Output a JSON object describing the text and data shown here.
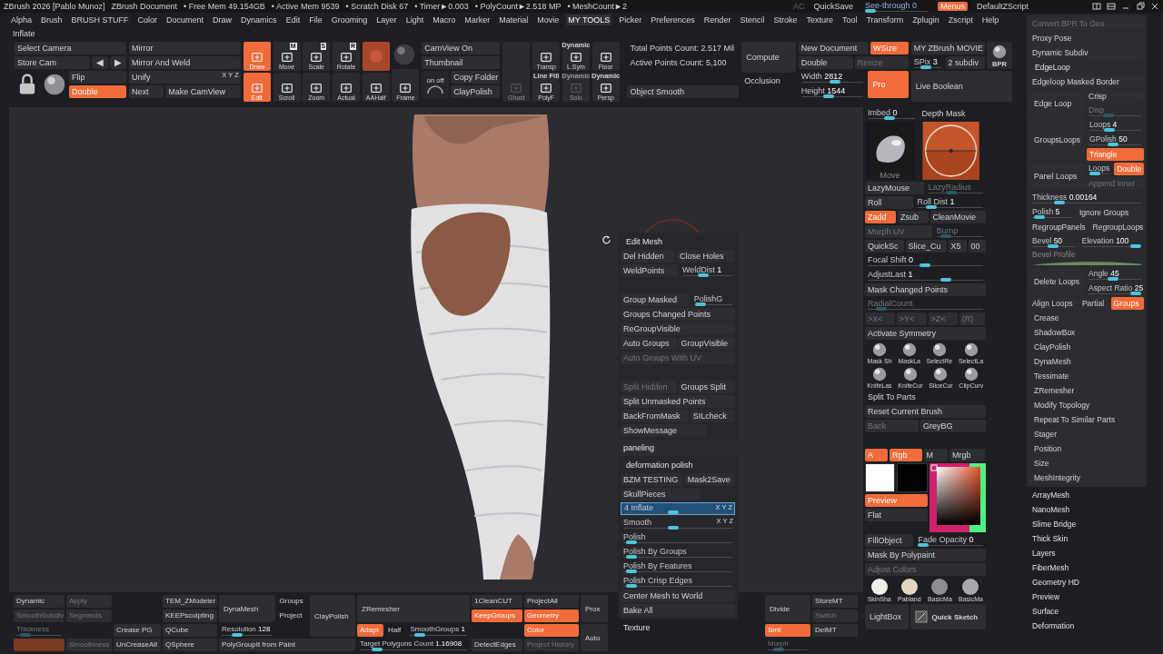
{
  "title_bar": {
    "app": "ZBrush 2026 [Pablo Munoz]",
    "document": "ZBrush Document",
    "stats": [
      "• Free Mem 49.154GB",
      "• Active Mem 9539",
      "• Scratch Disk 67",
      "• Timer►0.003",
      "• PolyCount►2.518 MP",
      "• MeshCount►2"
    ],
    "ac": "AC",
    "quicksave": "QuickSave",
    "see_through": {
      "text": "See-through",
      "value": "0",
      "level": 0
    },
    "menus": {
      "text": "Menus",
      "on": true
    },
    "script": "DefaultZScript"
  },
  "menu_bar": [
    {
      "text": "Alpha",
      "selected": false
    },
    {
      "text": "Brush",
      "selected": false
    },
    {
      "text": "BRUSH STUFF",
      "selected": false
    },
    {
      "text": "Color",
      "selected": false
    },
    {
      "text": "Document",
      "selected": false
    },
    {
      "text": "Draw",
      "selected": false
    },
    {
      "text": "Dynamics",
      "selected": false
    },
    {
      "text": "Edit",
      "selected": false
    },
    {
      "text": "File",
      "selected": false
    },
    {
      "text": "Grooming",
      "selected": false
    },
    {
      "text": "Layer",
      "selected": false
    },
    {
      "text": "Light",
      "selected": false
    },
    {
      "text": "Macro",
      "selected": false
    },
    {
      "text": "Marker",
      "selected": false
    },
    {
      "text": "Material",
      "selected": false
    },
    {
      "text": "Movie",
      "selected": false
    },
    {
      "text": "MY TOOLS",
      "selected": true
    },
    {
      "text": "Picker",
      "selected": false
    },
    {
      "text": "Preferences",
      "selected": false
    },
    {
      "text": "Render",
      "selected": false
    },
    {
      "text": "Stencil",
      "selected": false
    },
    {
      "text": "Stroke",
      "selected": false
    },
    {
      "text": "Texture",
      "selected": false
    },
    {
      "text": "Tool",
      "selected": false
    },
    {
      "text": "Transform",
      "selected": false
    },
    {
      "text": "Zplugin",
      "selected": false
    },
    {
      "text": "Zscript",
      "selected": false
    },
    {
      "text": "Help",
      "selected": false
    }
  ],
  "active_item": "Inflate",
  "toolbar": [
    {
      "kind": "stack",
      "items": [
        {
          "kind": "btn",
          "text": "Select Camera",
          "on": false
        },
        {
          "kind": "row",
          "items": [
            {
              "kind": "btn",
              "text": "Store Cam",
              "on": false
            },
            {
              "kind": "glyph",
              "text": "◀"
            },
            {
              "kind": "glyph",
              "text": "▶"
            }
          ]
        },
        {
          "kind": "row",
          "items": [
            {
              "kind": "lock"
            },
            {
              "kind": "sphere"
            },
            {
              "kind": "stack",
              "items": [
                {
                  "kind": "btn",
                  "text": "Flip",
                  "on": false
                },
                {
                  "kind": "btn",
                  "text": "Double",
                  "on": true
                }
              ]
            }
          ]
        }
      ]
    },
    {
      "kind": "stack",
      "items": [
        {
          "kind": "btn",
          "text": "Mirror",
          "on": false
        },
        {
          "kind": "btn",
          "text": "Mirror And Weld",
          "on": false
        },
        {
          "kind": "btn",
          "text": "Unify",
          "on": false,
          "tag": "X Y Z"
        },
        {
          "kind": "row",
          "items": [
            {
              "kind": "btn",
              "text": "Next",
              "on": false
            },
            {
              "kind": "btn",
              "text": "Make CamView",
              "on": false
            }
          ]
        }
      ]
    },
    {
      "kind": "stack",
      "items": [
        {
          "kind": "tool",
          "text": "Draw",
          "on": true
        },
        {
          "kind": "tool",
          "text": "Edit",
          "on": true
        }
      ]
    },
    {
      "kind": "stack",
      "items": [
        {
          "kind": "tool",
          "text": "Move",
          "key": "M",
          "on": false
        },
        {
          "kind": "tool",
          "text": "Scroll",
          "on": false
        }
      ]
    },
    {
      "kind": "stack",
      "items": [
        {
          "kind": "tool",
          "text": "Scale",
          "key": "S",
          "on": false
        },
        {
          "kind": "tool",
          "text": "Zoom",
          "on": false
        }
      ]
    },
    {
      "kind": "stack",
      "items": [
        {
          "kind": "tool",
          "text": "Rotate",
          "key": "R",
          "on": false
        },
        {
          "kind": "tool",
          "text": "Actual",
          "on": false
        }
      ]
    },
    {
      "kind": "stack",
      "items": [
        {
          "kind": "material-swatch"
        },
        {
          "kind": "tool",
          "text": "AAHalf",
          "on": false
        }
      ]
    },
    {
      "kind": "stack",
      "items": [
        {
          "kind": "dark-sphere"
        },
        {
          "kind": "tool",
          "text": "Frame",
          "on": false
        }
      ]
    },
    {
      "kind": "stack",
      "items": [
        {
          "kind": "btn",
          "text": "CamView On",
          "on": false
        },
        {
          "kind": "btn",
          "text": "Thumbnail",
          "on": false
        },
        {
          "kind": "row",
          "items": [
            {
              "kind": "dial",
              "text": "on off"
            },
            {
              "kind": "stack",
              "items": [
                {
                  "kind": "btn",
                  "text": "Copy Folder",
                  "on": false
                },
                {
                  "kind": "btn",
                  "text": "ClayPolish",
                  "on": false
                }
              ]
            }
          ]
        }
      ]
    },
    {
      "kind": "stack",
      "items": [
        {
          "kind": "dim-tool",
          "text": "Ghost"
        }
      ]
    },
    {
      "kind": "stack",
      "items": [
        {
          "kind": "tool",
          "text": "Transp",
          "on": false
        },
        {
          "kind": "tool",
          "text": "PolyF",
          "caption": "Line Fill",
          "on": false
        }
      ]
    },
    {
      "kind": "stack",
      "items": [
        {
          "kind": "tool",
          "text": "L.Sym",
          "caption": "Dynamic",
          "on": false
        },
        {
          "kind": "dim-tool",
          "text": "Solo",
          "caption": "Dynamic"
        }
      ]
    },
    {
      "kind": "stack",
      "items": [
        {
          "kind": "tool",
          "text": "Floor",
          "on": false
        },
        {
          "kind": "tool",
          "text": "Persp",
          "caption": "Dynamic",
          "on": false
        }
      ]
    },
    {
      "kind": "stack",
      "items": [
        {
          "kind": "text",
          "text": "Total Points Count: 2.517 Mil"
        },
        {
          "kind": "text",
          "text": "Active Points Count: 5,100"
        },
        {
          "kind": "gap"
        },
        {
          "kind": "btn",
          "text": "Object Smooth",
          "on": false
        }
      ]
    },
    {
      "kind": "stack",
      "items": [
        {
          "kind": "big-btn",
          "text": "Compute",
          "on": false
        },
        {
          "kind": "text",
          "text": "Occlusion"
        },
        {
          "kind": "gap"
        }
      ]
    },
    {
      "kind": "stack",
      "items": [
        {
          "kind": "row",
          "items": [
            {
              "kind": "btn",
              "text": "New Document",
              "on": false
            },
            {
              "kind": "btn",
              "text": "WSize",
              "on": true
            }
          ]
        },
        {
          "kind": "row",
          "items": [
            {
              "kind": "btn",
              "text": "Double",
              "on": false
            },
            {
              "kind": "dim",
              "text": "Resize"
            }
          ]
        },
        {
          "kind": "row",
          "items": [
            {
              "kind": "stack",
              "items": [
                {
                  "kind": "slider",
                  "text": "Width",
                  "value": "2812",
                  "level": 0.55
                },
                {
                  "kind": "slider",
                  "text": "Height",
                  "value": "1544",
                  "level": 0.42
                }
              ]
            },
            {
              "kind": "big-btn",
              "text": "Pro",
              "on": true
            }
          ]
        }
      ]
    },
    {
      "kind": "stack",
      "items": [
        {
          "kind": "row",
          "items": [
            {
              "kind": "stack",
              "items": [
                {
                  "kind": "btn",
                  "text": "MY ZBrush MOVIE",
                  "on": false
                },
                {
                  "kind": "row",
                  "items": [
                    {
                      "kind": "slider",
                      "text": "SPix",
                      "value": "3",
                      "level": 0.4
                    },
                    {
                      "kind": "btn",
                      "text": "2 subdiv",
                      "on": false
                    }
                  ]
                }
              ]
            },
            {
              "kind": "bpr",
              "text": "BPR"
            }
          ]
        },
        {
          "kind": "big-btn",
          "text": "Live Boolean",
          "on": false
        }
      ]
    }
  ],
  "popup_menu": [
    {
      "kind": "card",
      "items": [
        {
          "kind": "heading",
          "text": "Edit Mesh"
        },
        {
          "kind": "row",
          "items": [
            {
              "kind": "btn",
              "text": "Del Hidden",
              "on": false
            },
            {
              "kind": "btn",
              "text": "Close Holes",
              "on": false
            }
          ]
        },
        {
          "kind": "row",
          "items": [
            {
              "kind": "btn",
              "text": "WeldPoints",
              "on": false
            },
            {
              "kind": "slider",
              "text": "WeldDist",
              "value": "1",
              "level": 0.4
            }
          ]
        },
        {
          "kind": "gap"
        },
        {
          "kind": "row",
          "items": [
            {
              "kind": "btn",
              "text": "Group Masked",
              "on": false
            },
            {
              "kind": "slider",
              "text": "PolishG",
              "level": 0.05
            }
          ]
        },
        {
          "kind": "btn",
          "text": "Groups Changed Points",
          "on": false
        },
        {
          "kind": "btn",
          "text": "ReGroupVisible",
          "on": false
        },
        {
          "kind": "row",
          "items": [
            {
              "kind": "btn",
              "text": "Auto Groups",
              "on": false
            },
            {
              "kind": "btn",
              "text": "GroupVisible",
              "on": false
            }
          ]
        },
        {
          "kind": "dim",
          "text": "Auto Groups With UV"
        },
        {
          "kind": "gap"
        },
        {
          "kind": "row",
          "items": [
            {
              "kind": "dim",
              "text": "Split Hidden"
            },
            {
              "kind": "btn",
              "text": "Groups Split",
              "on": false
            }
          ]
        },
        {
          "kind": "btn",
          "text": "Split Unmasked Points",
          "on": false
        },
        {
          "kind": "row",
          "items": [
            {
              "kind": "btn",
              "text": "BackFromMask",
              "on": false
            },
            {
              "kind": "btn",
              "text": "SILcheck",
              "on": false
            }
          ]
        },
        {
          "kind": "row",
          "items": [
            {
              "kind": "btn",
              "text": "ShowMessage",
              "on": false
            },
            {
              "kind": "gap"
            }
          ]
        }
      ]
    },
    {
      "kind": "heading",
      "text": "paneling"
    },
    {
      "kind": "card",
      "items": [
        {
          "kind": "heading",
          "text": "deformation polish"
        },
        {
          "kind": "row",
          "items": [
            {
              "kind": "btn",
              "text": "BZM TESTING",
              "on": false
            },
            {
              "kind": "btn",
              "text": "Mask2Save",
              "on": false
            }
          ]
        },
        {
          "kind": "row",
          "items": [
            {
              "kind": "btn",
              "text": "SkullPieces",
              "on": false
            },
            {
              "kind": "gap"
            }
          ]
        },
        {
          "kind": "slider",
          "text": "4 Inflate",
          "level": 0.45,
          "selected": true,
          "tag": "X Y Z"
        },
        {
          "kind": "slider",
          "text": "Smooth",
          "level": 0.45,
          "selected": false,
          "tag": "X Y Z"
        },
        {
          "kind": "slider",
          "text": "Polish",
          "level": 0.03,
          "selected": false
        },
        {
          "kind": "slider",
          "text": "Polish By Groups",
          "level": 0.03,
          "selected": false
        },
        {
          "kind": "slider",
          "text": "Polish By Features",
          "level": 0.03,
          "selected": false
        },
        {
          "kind": "slider",
          "text": "Polish Crisp Edges",
          "level": 0.03,
          "selected": false
        },
        {
          "kind": "btn",
          "text": "Center Mesh to World",
          "on": false
        },
        {
          "kind": "btn",
          "text": "Bake All",
          "on": false
        }
      ]
    },
    {
      "kind": "heading",
      "text": "Texture"
    }
  ],
  "bottom_bar": {
    "left": [
      {
        "kind": "stack",
        "items": [
          {
            "kind": "btn",
            "text": "Dynamic",
            "on": false
          },
          {
            "kind": "dim",
            "text": "SmoothSubdiv"
          },
          {
            "kind": "dim-slider",
            "text": "Thickness",
            "level": 0.1
          },
          {
            "kind": "bar"
          }
        ]
      },
      {
        "kind": "stack",
        "items": [
          {
            "kind": "dim",
            "text": "Apply"
          },
          {
            "kind": "dim",
            "text": "Segments"
          },
          {
            "kind": "gap"
          },
          {
            "kind": "dim",
            "text": "Smoothness"
          }
        ]
      },
      {
        "kind": "stack",
        "items": [
          {
            "kind": "gap"
          },
          {
            "kind": "gap"
          },
          {
            "kind": "btn",
            "text": "Crease PG",
            "on": false
          },
          {
            "kind": "btn",
            "text": "UnCreaseAll",
            "on": false
          }
        ]
      },
      {
        "kind": "stack",
        "items": [
          {
            "kind": "btn",
            "text": "TEM_ZModeler",
            "on": false
          },
          {
            "kind": "btn",
            "text": "KEEPsculpting",
            "on": false
          },
          {
            "kind": "btn",
            "text": "QCube",
            "on": false
          },
          {
            "kind": "btn",
            "text": "QSphere",
            "on": false
          }
        ]
      },
      {
        "kind": "stack",
        "items": [
          {
            "kind": "row",
            "items": [
              {
                "kind": "stack",
                "items": [
                  {
                    "kind": "big-btn",
                    "text": "DynaMesh",
                    "on": false
                  },
                  {
                    "kind": "slider",
                    "text": "Resolution",
                    "value": "128",
                    "level": 0.25
                  }
                ]
              },
              {
                "kind": "stack",
                "items": [
                  {
                    "kind": "text",
                    "text": "Groups"
                  },
                  {
                    "kind": "text",
                    "text": "Project"
                  },
                  {
                    "kind": "gap"
                  }
                ]
              },
              {
                "kind": "big-btn",
                "text": "ClayPolish",
                "on": false
              }
            ]
          },
          {
            "kind": "btn",
            "text": "PolyGroupIt from Paint",
            "on": false
          }
        ]
      },
      {
        "kind": "stack",
        "items": [
          {
            "kind": "big-btn",
            "text": "ZRemesher",
            "on": false
          },
          {
            "kind": "row",
            "items": [
              {
                "kind": "btn",
                "text": "Adapt",
                "on": true
              },
              {
                "kind": "text",
                "text": "Half"
              },
              {
                "kind": "slider",
                "text": "SmoothGroups",
                "value": "1",
                "level": 0.1
              }
            ]
          },
          {
            "kind": "slider",
            "text": "Target Polygons Count",
            "value": "1.16908",
            "level": 0.12
          }
        ]
      },
      {
        "kind": "stack",
        "items": [
          {
            "kind": "btn",
            "text": "1CleanCUT",
            "on": false
          },
          {
            "kind": "btn",
            "text": "KeepGroups",
            "on": true
          },
          {
            "kind": "gap"
          },
          {
            "kind": "btn",
            "text": "DetectEdges",
            "on": false
          }
        ]
      },
      {
        "kind": "stack",
        "items": [
          {
            "kind": "btn",
            "text": "ProjectAll",
            "on": false
          },
          {
            "kind": "btn",
            "text": "Geometry",
            "on": true
          },
          {
            "kind": "btn",
            "text": "Color",
            "on": true
          },
          {
            "kind": "dim",
            "text": "Project History"
          }
        ]
      },
      {
        "kind": "stack",
        "items": [
          {
            "kind": "big-btn",
            "text": "Prox",
            "on": false
          },
          {
            "kind": "big-btn",
            "text": "Auto",
            "on": false
          }
        ]
      }
    ],
    "right": [
      {
        "kind": "stack",
        "items": [
          {
            "kind": "big-btn",
            "text": "Divide",
            "on": false
          },
          {
            "kind": "btn",
            "text": "Smt",
            "on": true
          },
          {
            "kind": "dim-slider",
            "text": "Morph",
            "level": 0.2
          }
        ]
      },
      {
        "kind": "stack",
        "items": [
          {
            "kind": "btn",
            "text": "StoreMT",
            "on": false
          },
          {
            "kind": "dim",
            "text": "Switch"
          },
          {
            "kind": "btn",
            "text": "DelMT",
            "on": false
          },
          {
            "kind": "gap"
          }
        ]
      }
    ]
  },
  "brush_panel": [
    {
      "kind": "row",
      "items": [
        {
          "kind": "slider",
          "text": "Imbed",
          "value": "0",
          "level": 0.45
        },
        {
          "kind": "text",
          "text": "Depth Mask"
        }
      ]
    },
    {
      "kind": "row",
      "items": [
        {
          "kind": "brush-thumb",
          "text": "Move"
        },
        {
          "kind": "stroke-circle"
        }
      ]
    },
    {
      "kind": "row",
      "items": [
        {
          "kind": "btn",
          "text": "LazyMouse",
          "on": false
        },
        {
          "kind": "dim-slider",
          "text": "LazyRadius",
          "level": 0.4
        }
      ]
    },
    {
      "kind": "row",
      "items": [
        {
          "kind": "btn",
          "text": "Roll",
          "on": false
        },
        {
          "kind": "slider",
          "text": "Roll Dist",
          "value": "1",
          "level": 0.15
        }
      ]
    },
    {
      "kind": "row",
      "items": [
        {
          "kind": "btn",
          "text": "Zadd",
          "on": true
        },
        {
          "kind": "btn",
          "text": "Zsub",
          "on": false
        },
        {
          "kind": "btn",
          "text": "CleanMovie",
          "on": false
        }
      ]
    },
    {
      "kind": "row",
      "items": [
        {
          "kind": "dim",
          "text": "Morph UV"
        },
        {
          "kind": "dim-slider",
          "text": "Bump",
          "level": 0.1
        }
      ]
    },
    {
      "kind": "row",
      "items": [
        {
          "kind": "btn",
          "text": "QuickSc",
          "on": false
        },
        {
          "kind": "btn",
          "text": "Slice_Cu",
          "on": false
        },
        {
          "kind": "btn",
          "text": "X5",
          "on": false
        },
        {
          "kind": "btn",
          "text": "00",
          "on": false
        }
      ]
    },
    {
      "kind": "slider",
      "text": "Focal Shift",
      "value": "0",
      "level": 0.5
    },
    {
      "kind": "slider",
      "text": "AdjustLast",
      "value": "1",
      "level": 0.7
    },
    {
      "kind": "btn",
      "text": "Mask Changed Points",
      "on": false
    },
    {
      "kind": "dim-slider",
      "text": "RadialCount",
      "level": 0.08
    },
    {
      "kind": "row",
      "items": [
        {
          "kind": "dim",
          "text": ">X<"
        },
        {
          "kind": "dim",
          "text": ">Y<"
        },
        {
          "kind": "dim",
          "text": ">Z<"
        },
        {
          "kind": "dim",
          "text": "(R)"
        }
      ]
    },
    {
      "kind": "btn",
      "text": "Activate Symmetry",
      "on": false
    },
    {
      "kind": "row",
      "items": [
        {
          "kind": "brush",
          "text": "Mask Sh"
        },
        {
          "kind": "brush",
          "text": "MaskLa"
        },
        {
          "kind": "brush",
          "text": "SelectRe"
        },
        {
          "kind": "brush",
          "text": "SelectLa"
        }
      ]
    },
    {
      "kind": "row",
      "items": [
        {
          "kind": "brush",
          "text": "KnifeLas"
        },
        {
          "kind": "brush",
          "text": "KnifeCur"
        },
        {
          "kind": "brush",
          "text": "SliceCur"
        },
        {
          "kind": "brush",
          "text": "ClipCurv"
        }
      ]
    },
    {
      "kind": "text",
      "text": "Split To Parts"
    },
    {
      "kind": "btn",
      "text": "Reset Current Brush",
      "on": false
    },
    {
      "kind": "row",
      "items": [
        {
          "kind": "dim",
          "text": "Back"
        },
        {
          "kind": "btn",
          "text": "GreyBG",
          "on": false
        }
      ]
    },
    {
      "kind": "gap"
    },
    {
      "kind": "row",
      "items": [
        {
          "kind": "btn",
          "text": "A",
          "on": true
        },
        {
          "kind": "btn",
          "text": "Rgb",
          "on": true
        },
        {
          "kind": "btn",
          "text": "M",
          "on": false
        },
        {
          "kind": "btn",
          "text": "Mrgb",
          "on": false
        }
      ]
    },
    {
      "kind": "row",
      "items": [
        {
          "kind": "stack",
          "items": [
            {
              "kind": "row",
              "items": [
                {
                  "kind": "color-swatch",
                  "color": "#ffffff"
                },
                {
                  "kind": "color-swatch",
                  "color": "#000000"
                }
              ]
            },
            {
              "kind": "btn",
              "text": "Preview",
              "on": true
            },
            {
              "kind": "btn",
              "text": "Flat",
              "on": false
            }
          ]
        },
        {
          "kind": "picker"
        }
      ]
    },
    {
      "kind": "row",
      "items": [
        {
          "kind": "btn",
          "text": "FillObject",
          "on": false
        },
        {
          "kind": "slider",
          "text": "Fade Opacity",
          "value": "0",
          "level": 0
        }
      ]
    },
    {
      "kind": "btn",
      "text": "Mask By Polypaint",
      "on": false
    },
    {
      "kind": "dim",
      "text": "Adjust Colors"
    },
    {
      "kind": "row",
      "items": [
        {
          "kind": "material",
          "text": "SkinSha",
          "color": "#f2efe8"
        },
        {
          "kind": "material",
          "text": "Pabland",
          "color": "#e0d6c4"
        },
        {
          "kind": "material",
          "text": "BasicMa",
          "color": "#8e8e92"
        },
        {
          "kind": "material",
          "text": "BasicMa",
          "color": "#a8a8ac"
        }
      ]
    },
    {
      "kind": "row",
      "items": [
        {
          "kind": "big-btn",
          "text": "LightBox",
          "on": false
        },
        {
          "kind": "quick-sketch",
          "text": "Quick Sketch"
        }
      ]
    }
  ],
  "tray": [
    {
      "kind": "card",
      "items": [
        {
          "kind": "dim",
          "text": "Convert BPR To Geo"
        },
        {
          "kind": "btn",
          "text": "Proxy Pose",
          "on": false
        },
        {
          "kind": "btn",
          "text": "Dynamic Subdiv",
          "on": false
        },
        {
          "kind": "heading",
          "text": "EdgeLoop"
        },
        {
          "kind": "btn",
          "text": "Edgeloop Masked Border",
          "on": false
        },
        {
          "kind": "row",
          "items": [
            {
              "kind": "big-btn",
              "text": "Edge Loop",
              "on": false
            },
            {
              "kind": "stack",
              "items": [
                {
                  "kind": "btn",
                  "text": "Crisp",
                  "on": false
                },
                {
                  "kind": "dim-slider",
                  "text": "Disp",
                  "level": 0.35
                }
              ]
            }
          ]
        },
        {
          "kind": "row",
          "items": [
            {
              "kind": "big-btn",
              "text": "GroupsLoops",
              "on": false
            },
            {
              "kind": "stack",
              "items": [
                {
                  "kind": "slider",
                  "text": "Loops",
                  "value": "4",
                  "level": 0.35
                },
                {
                  "kind": "slider",
                  "text": "GPolish",
                  "value": "50",
                  "level": 0.45
                },
                {
                  "kind": "btn",
                  "text": "Triangle",
                  "on": true
                }
              ]
            }
          ]
        },
        {
          "kind": "row",
          "items": [
            {
              "kind": "big-btn",
              "text": "Panel Loops",
              "on": false
            },
            {
              "kind": "stack",
              "items": [
                {
                  "kind": "row",
                  "items": [
                    {
                      "kind": "slider",
                      "text": "Loops",
                      "level": 0.1
                    },
                    {
                      "kind": "btn",
                      "text": "Double",
                      "on": true
                    }
                  ]
                },
                {
                  "kind": "dim",
                  "text": "Append Inner"
                }
              ]
            }
          ]
        },
        {
          "kind": "slider",
          "text": "Thickness",
          "value": "0.00164",
          "level": 0.22
        },
        {
          "kind": "row",
          "items": [
            {
              "kind": "slider",
              "text": "Polish",
              "value": "5",
              "level": 0.05
            },
            {
              "kind": "btn",
              "text": "Ignore Groups",
              "on": false
            }
          ]
        },
        {
          "kind": "row",
          "items": [
            {
              "kind": "btn",
              "text": "RegroupPanels",
              "on": false
            },
            {
              "kind": "btn",
              "text": "RegroupLoops",
              "on": false
            }
          ]
        },
        {
          "kind": "row",
          "items": [
            {
              "kind": "slider",
              "text": "Bevel",
              "value": "50",
              "level": 0.5
            },
            {
              "kind": "slider",
              "text": "Elevation",
              "value": "100",
              "level": 1
            }
          ]
        },
        {
          "kind": "curve",
          "text": "Bevel Profile"
        },
        {
          "kind": "row",
          "items": [
            {
              "kind": "big-btn",
              "text": "Delete Loops",
              "on": false
            },
            {
              "kind": "stack",
              "items": [
                {
                  "kind": "slider",
                  "text": "Angle",
                  "value": "45",
                  "level": 0.45
                },
                {
                  "kind": "slider",
                  "text": "Aspect Ratio",
                  "value": "25",
                  "level": 1
                }
              ]
            }
          ]
        },
        {
          "kind": "row",
          "items": [
            {
              "kind": "btn",
              "text": "Align Loops",
              "on": false
            },
            {
              "kind": "btn",
              "text": "Partial",
              "on": false
            },
            {
              "kind": "btn",
              "text": "Groups",
              "on": true
            }
          ]
        },
        {
          "kind": "item",
          "text": "Crease"
        },
        {
          "kind": "item",
          "text": "ShadowBox"
        },
        {
          "kind": "item",
          "text": "ClayPolish"
        },
        {
          "kind": "item",
          "text": "DynaMesh"
        },
        {
          "kind": "item",
          "text": "Tessimate"
        },
        {
          "kind": "item",
          "text": "ZRemesher"
        },
        {
          "kind": "item",
          "text": "Modify Topology"
        },
        {
          "kind": "item",
          "text": "Repeat To Similar Parts"
        },
        {
          "kind": "item",
          "text": "Stager"
        },
        {
          "kind": "item",
          "text": "Position"
        },
        {
          "kind": "item",
          "text": "Size"
        },
        {
          "kind": "item",
          "text": "MeshIntegrity"
        }
      ]
    },
    {
      "kind": "heading",
      "text": "ArrayMesh"
    },
    {
      "kind": "heading",
      "text": "NanoMesh"
    },
    {
      "kind": "heading",
      "text": "Slime Bridge"
    },
    {
      "kind": "heading",
      "text": "Thick Skin"
    },
    {
      "kind": "heading",
      "text": "Layers"
    },
    {
      "kind": "heading",
      "text": "FiberMesh"
    },
    {
      "kind": "heading",
      "text": "Geometry HD"
    },
    {
      "kind": "heading",
      "text": "Preview"
    },
    {
      "kind": "heading",
      "text": "Surface"
    },
    {
      "kind": "heading",
      "text": "Deformation"
    }
  ]
}
